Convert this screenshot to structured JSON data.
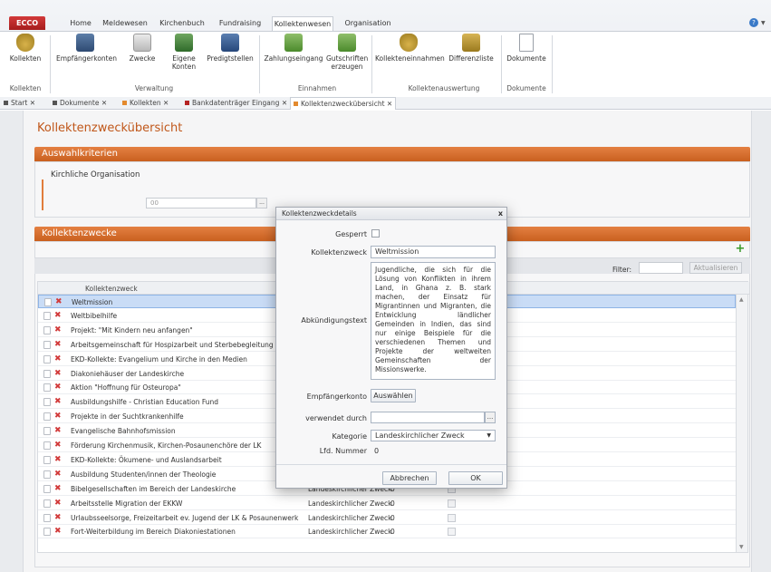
{
  "app": {
    "logo_text": "ECCO"
  },
  "ribbon_tabs": [
    {
      "label": "Home"
    },
    {
      "label": "Meldewesen"
    },
    {
      "label": "Kirchenbuch"
    },
    {
      "label": "Fundraising"
    },
    {
      "label": "Kollektenwesen",
      "active": true
    },
    {
      "label": "Organisation"
    }
  ],
  "ribbon": {
    "buttons": [
      {
        "label": "Kollekten",
        "icon": "money-bag-icon"
      },
      {
        "label": "Empfängerkonten",
        "icon": "bank-account-icon"
      },
      {
        "label": "Zwecke",
        "icon": "purpose-list-icon"
      },
      {
        "label": "Eigene Konten",
        "icon": "own-accounts-icon"
      },
      {
        "label": "Predigtstellen",
        "icon": "church-building-icon"
      },
      {
        "label": "Zahlungseingang",
        "icon": "payment-incoming-icon"
      },
      {
        "label": "Gutschriften erzeugen",
        "icon": "credit-generate-icon"
      },
      {
        "label": "Kollekteneinnahmen",
        "icon": "collection-revenue-icon"
      },
      {
        "label": "Differenzliste",
        "icon": "scales-icon"
      },
      {
        "label": "Dokumente",
        "icon": "document-icon"
      }
    ],
    "groups": [
      {
        "label": "Kollekten"
      },
      {
        "label": "Verwaltung"
      },
      {
        "label": "Einnahmen"
      },
      {
        "label": "Kollektenauswertung"
      },
      {
        "label": "Dokumente"
      }
    ]
  },
  "doc_tabs": [
    {
      "label": "Start",
      "color": "#555555"
    },
    {
      "label": "Dokumente",
      "color": "#555555"
    },
    {
      "label": "Kollekten",
      "color": "#e38a2e"
    },
    {
      "label": "Bankdatenträger Eingang",
      "color": "#b52323"
    },
    {
      "label": "Kollektenzweckübersicht",
      "color": "#e38a2e",
      "active": true
    }
  ],
  "page": {
    "title": "Kollektenzweckübersicht",
    "criteria_header": "Auswahlkriterien",
    "org_label": "Kirchliche Organisation",
    "org_value": "00",
    "list_header": "Kollektenzwecke",
    "filter_label": "Filter:",
    "filter_value": "",
    "update_button": "Aktualisieren",
    "column_header": "Kollektenzweck"
  },
  "rows": [
    {
      "name": "Weltmission",
      "category": "",
      "number": "",
      "selected": true
    },
    {
      "name": "Weltbibelhilfe",
      "category": "",
      "number": ""
    },
    {
      "name": "Projekt: \"Mit Kindern neu anfangen\"",
      "category": "",
      "number": ""
    },
    {
      "name": "Arbeitsgemeinschaft für Hospizarbeit und Sterbebegleitung",
      "category": "",
      "number": ""
    },
    {
      "name": "EKD-Kollekte: Evangelium und Kirche in den Medien",
      "category": "",
      "number": ""
    },
    {
      "name": "Diakoniehäuser der Landeskirche",
      "category": "",
      "number": ""
    },
    {
      "name": "Aktion \"Hoffnung für Osteuropa\"",
      "category": "",
      "number": ""
    },
    {
      "name": "Ausbildungshilfe - Christian Education Fund",
      "category": "",
      "number": ""
    },
    {
      "name": "Projekte in der Suchtkrankenhilfe",
      "category": "",
      "number": ""
    },
    {
      "name": "Evangelische Bahnhofsmission",
      "category": "",
      "number": ""
    },
    {
      "name": "Förderung Kirchenmusik, Kirchen-Posaunenchöre der LK",
      "category": "",
      "number": ""
    },
    {
      "name": "EKD-Kollekte: Ökumene- und Auslandsarbeit",
      "category": "",
      "number": ""
    },
    {
      "name": "Ausbildung Studenten/innen der Theologie",
      "category": "",
      "number": ""
    },
    {
      "name": "Bibelgesellschaften im Bereich der Landeskirche",
      "category": "Landeskirchlicher Zweck",
      "number": "0"
    },
    {
      "name": "Arbeitsstelle Migration der EKKW",
      "category": "Landeskirchlicher Zweck",
      "number": "0"
    },
    {
      "name": "Urlaubsseelsorge, Freizeitarbeit ev. Jugend der LK & Posaunenwerk",
      "category": "Landeskirchlicher Zweck",
      "number": "0"
    },
    {
      "name": "Fort-Weiterbildung im Bereich Diakoniestationen",
      "category": "Landeskirchlicher Zweck",
      "number": "0"
    }
  ],
  "dialog": {
    "title": "Kollektenzweckdetails",
    "close": "x",
    "locked_label": "Gesperrt",
    "purpose_label": "Kollektenzweck",
    "purpose_value": "Weltmission",
    "announcement_label": "Abkündigungstext",
    "announcement_value": "Jugendliche, die sich für die Lösung von Konflikten in ihrem Land, in Ghana z. B. stark machen, der Einsatz für Migrantinnen und Migranten, die Entwicklung ländlicher Gemeinden in Indien, das sind nur einige Beispiele für die verschiedenen Themen und Projekte der weltweiten Gemeinschaften der Missionswerke.",
    "recipient_label": "Empfängerkonto",
    "select_button": "Auswählen",
    "used_by_label": "verwendet durch",
    "used_by_value": "",
    "ellipsis": "...",
    "category_label": "Kategorie",
    "category_value": "Landeskirchlicher Zweck",
    "number_label": "Lfd. Nummer",
    "number_value": "0",
    "cancel_button": "Abbrechen",
    "ok_button": "OK"
  }
}
